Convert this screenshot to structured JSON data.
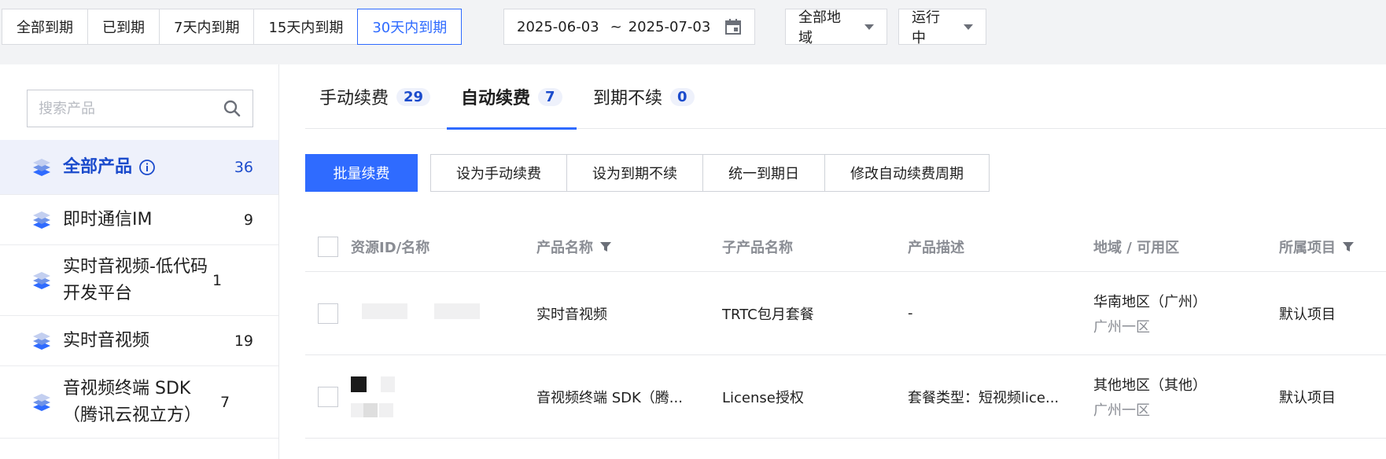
{
  "filters": {
    "expiry_segments": [
      "全部到期",
      "已到期",
      "7天内到期",
      "15天内到期",
      "30天内到期"
    ],
    "active_segment": 4,
    "date_start": "2025-06-03",
    "date_sep": "~",
    "date_end": "2025-07-03",
    "region_select": "全部地域",
    "status_select": "运行中"
  },
  "sidebar": {
    "search_placeholder": "搜索产品",
    "products": [
      {
        "label": "全部产品",
        "count": "36"
      },
      {
        "label": "即时通信IM",
        "count": "9"
      },
      {
        "label": "实时音视频-低代码开发平台",
        "count": "1"
      },
      {
        "label": "实时音视频",
        "count": "19"
      },
      {
        "label": "音视频终端 SDK（腾讯云视立方）",
        "count": "7"
      }
    ]
  },
  "tabs": [
    {
      "label": "手动续费",
      "count": "29"
    },
    {
      "label": "自动续费",
      "count": "7"
    },
    {
      "label": "到期不续",
      "count": "0"
    }
  ],
  "actions": {
    "primary": "批量续费",
    "buttons": [
      "设为手动续费",
      "设为到期不续",
      "统一到期日",
      "修改自动续费周期"
    ]
  },
  "table": {
    "headers": [
      "资源ID/名称",
      "产品名称",
      "子产品名称",
      "产品描述",
      "地域 / 可用区",
      "所属项目"
    ],
    "rows": [
      {
        "product": "实时音视频",
        "sub_product": "TRTC包月套餐",
        "desc": "-",
        "region": "华南地区（广州）",
        "zone": "广州一区",
        "project": "默认项目"
      },
      {
        "product": "音视频终端 SDK（腾...",
        "sub_product": "License授权",
        "desc": "套餐类型：短视频lice...",
        "region": "其他地区（其他）",
        "zone": "广州一区",
        "project": "默认项目"
      }
    ]
  },
  "colors": {
    "accent": "#2f6bff",
    "active_text": "#1b4bcc",
    "active_bg": "#eef1fb",
    "muted": "#8a8d94"
  }
}
